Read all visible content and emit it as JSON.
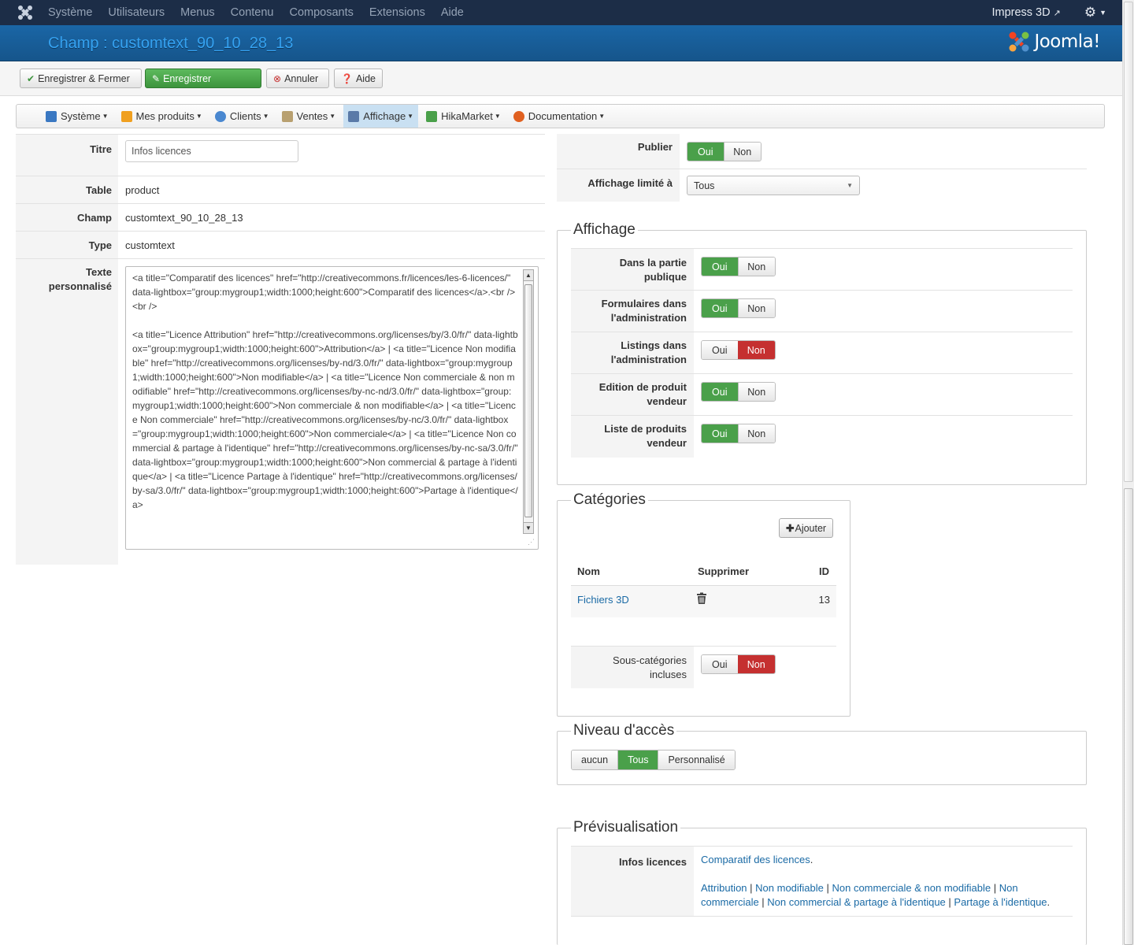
{
  "topbar": {
    "menu": [
      "Système",
      "Utilisateurs",
      "Menus",
      "Contenu",
      "Composants",
      "Extensions",
      "Aide"
    ],
    "site_name": "Impress 3D"
  },
  "header": {
    "title": "Champ : customtext_90_10_28_13",
    "brand": "Joomla!"
  },
  "toolbar": {
    "save_close": "Enregistrer & Fermer",
    "save": "Enregistrer",
    "cancel": "Annuler",
    "help": "Aide"
  },
  "hikamenu": [
    {
      "label": "Système",
      "color": "#3a78c2"
    },
    {
      "label": "Mes produits",
      "color": "#f0a020"
    },
    {
      "label": "Clients",
      "color": "#4a88d0"
    },
    {
      "label": "Ventes",
      "color": "#b8a070"
    },
    {
      "label": "Affichage",
      "color": "#5a7aa8"
    },
    {
      "label": "HikaMarket",
      "color": "#4aa04a"
    },
    {
      "label": "Documentation",
      "color": "#e06020"
    }
  ],
  "form": {
    "titre_label": "Titre",
    "titre_value": "Infos licences",
    "table_label": "Table",
    "table_value": "product",
    "champ_label": "Champ",
    "champ_value": "customtext_90_10_28_13",
    "type_label": "Type",
    "type_value": "customtext",
    "texte_label": "Texte personnalisé",
    "texte_value": "<a title=\"Comparatif des licences\" href=\"http://creativecommons.fr/licences/les-6-licences/\" data-lightbox=\"group:mygroup1;width:1000;height:600\">Comparatif des licences</a>.<br /><br />\n\n<a title=\"Licence Attribution\" href=\"http://creativecommons.org/licenses/by/3.0/fr/\" data-lightbox=\"group:mygroup1;width:1000;height:600\">Attribution</a> | <a title=\"Licence Non modifiable\" href=\"http://creativecommons.org/licenses/by-nd/3.0/fr/\" data-lightbox=\"group:mygroup1;width:1000;height:600\">Non modifiable</a> | <a title=\"Licence Non commerciale & non modifiable\" href=\"http://creativecommons.org/licenses/by-nc-nd/3.0/fr/\" data-lightbox=\"group:mygroup1;width:1000;height:600\">Non commerciale & non modifiable</a> | <a title=\"Licence Non commerciale\" href=\"http://creativecommons.org/licenses/by-nc/3.0/fr/\" data-lightbox=\"group:mygroup1;width:1000;height:600\">Non commerciale</a> | <a title=\"Licence Non commercial & partage à l'identique\" href=\"http://creativecommons.org/licenses/by-nc-sa/3.0/fr/\" data-lightbox=\"group:mygroup1;width:1000;height:600\">Non commercial & partage à l'identique</a> | <a title=\"Licence Partage à l'identique\" href=\"http://creativecommons.org/licenses/by-sa/3.0/fr/\" data-lightbox=\"group:mygroup1;width:1000;height:600\">Partage à l'identique</a>"
  },
  "right": {
    "publier_label": "Publier",
    "affichage_limite_label": "Affichage limité à",
    "affichage_limite_value": "Tous",
    "oui": "Oui",
    "non": "Non"
  },
  "affichage": {
    "legend": "Affichage",
    "rows": [
      {
        "label": "Dans la partie publique",
        "selected": "Oui"
      },
      {
        "label": "Formulaires dans l'administration",
        "selected": "Oui"
      },
      {
        "label": "Listings dans l'administration",
        "selected": "Non"
      },
      {
        "label": "Edition de produit vendeur",
        "selected": "Oui"
      },
      {
        "label": "Liste de produits vendeur",
        "selected": "Oui"
      }
    ]
  },
  "categories": {
    "legend": "Catégories",
    "add_button": "Ajouter",
    "col_nom": "Nom",
    "col_supprimer": "Supprimer",
    "col_id": "ID",
    "items": [
      {
        "name": "Fichiers 3D",
        "id": "13"
      }
    ],
    "sub_label": "Sous-catégories incluses",
    "sub_selected": "Non"
  },
  "niveau": {
    "legend": "Niveau d'accès",
    "options": [
      "aucun",
      "Tous",
      "Personnalisé"
    ],
    "selected": "Tous"
  },
  "preview": {
    "legend": "Prévisualisation",
    "label": "Infos licences",
    "link_compare": "Comparatif des licences",
    "links": [
      "Attribution",
      "Non modifiable",
      "Non commerciale & non modifiable",
      "Non commerciale",
      "Non commercial & partage à l'identique",
      "Partage à l'identique"
    ]
  },
  "colors": {
    "green": "#4aa04a",
    "red": "#c53030",
    "header_blue": "#1a66a6",
    "topbar": "#1c2d47"
  }
}
